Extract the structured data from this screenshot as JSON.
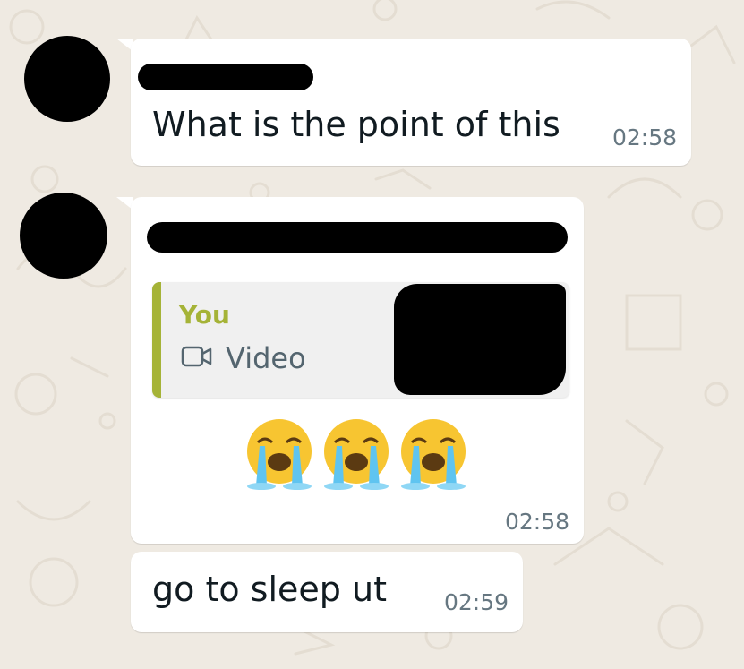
{
  "chat": {
    "messages": [
      {
        "sender_redacted": true,
        "text": "What is the point of this",
        "time": "02:58"
      },
      {
        "sender_redacted": true,
        "reply_quote": {
          "author": "You",
          "media_icon": "video-camera-icon",
          "media_label": "Video",
          "thumbnail_redacted": true
        },
        "emoji": [
          "😭",
          "😭",
          "😭"
        ],
        "emoji_name": "loudly-crying-face-icon",
        "time": "02:58"
      },
      {
        "text": "go to sleep ut",
        "time": "02:59"
      }
    ]
  },
  "colors": {
    "background": "#efeae2",
    "bubble": "#ffffff",
    "quote_accent": "#a5b337",
    "timestamp": "#667781"
  }
}
